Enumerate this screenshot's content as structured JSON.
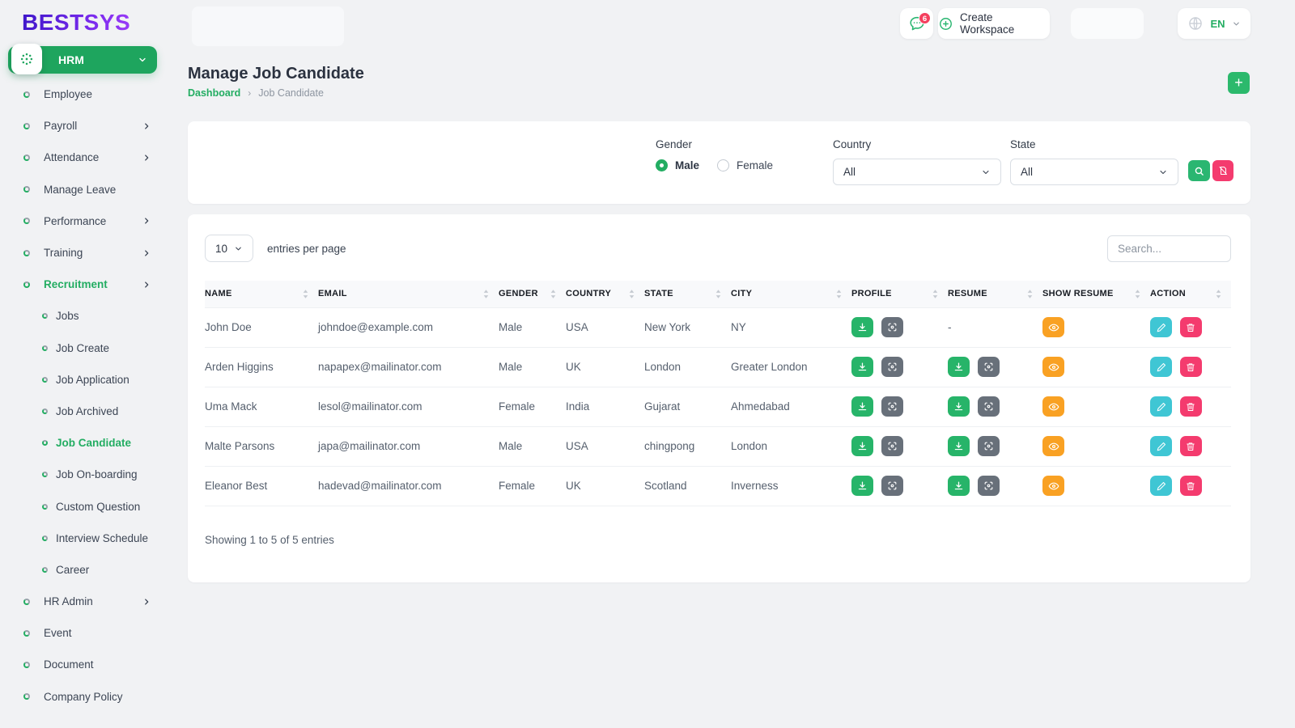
{
  "brand": {
    "logo_text": "BESTSYS"
  },
  "header": {
    "chat_badge_count": "6",
    "create_workspace_label": "Create Workspace",
    "language_code": "EN"
  },
  "sidebar": {
    "module_label": "HRM",
    "items": [
      {
        "label": "Employee",
        "chevron": false,
        "active": false,
        "indent": false
      },
      {
        "label": "Payroll",
        "chevron": true,
        "active": false,
        "indent": false
      },
      {
        "label": "Attendance",
        "chevron": true,
        "active": false,
        "indent": false
      },
      {
        "label": "Manage Leave",
        "chevron": false,
        "active": false,
        "indent": false
      },
      {
        "label": "Performance",
        "chevron": true,
        "active": false,
        "indent": false
      },
      {
        "label": "Training",
        "chevron": true,
        "active": false,
        "indent": false
      },
      {
        "label": "Recruitment",
        "chevron": true,
        "active": true,
        "indent": false
      },
      {
        "label": "Jobs",
        "chevron": false,
        "active": false,
        "indent": true
      },
      {
        "label": "Job Create",
        "chevron": false,
        "active": false,
        "indent": true
      },
      {
        "label": "Job Application",
        "chevron": false,
        "active": false,
        "indent": true
      },
      {
        "label": "Job Archived",
        "chevron": false,
        "active": false,
        "indent": true
      },
      {
        "label": "Job Candidate",
        "chevron": false,
        "active": true,
        "indent": true
      },
      {
        "label": "Job On-boarding",
        "chevron": false,
        "active": false,
        "indent": true
      },
      {
        "label": "Custom Question",
        "chevron": false,
        "active": false,
        "indent": true
      },
      {
        "label": "Interview Schedule",
        "chevron": false,
        "active": false,
        "indent": true
      },
      {
        "label": "Career",
        "chevron": false,
        "active": false,
        "indent": true
      },
      {
        "label": "HR Admin",
        "chevron": true,
        "active": false,
        "indent": false
      },
      {
        "label": "Event",
        "chevron": false,
        "active": false,
        "indent": false
      },
      {
        "label": "Document",
        "chevron": false,
        "active": false,
        "indent": false
      },
      {
        "label": "Company Policy",
        "chevron": false,
        "active": false,
        "indent": false
      }
    ]
  },
  "page": {
    "title": "Manage Job Candidate",
    "breadcrumb_home": "Dashboard",
    "breadcrumb_current": "Job Candidate"
  },
  "filters": {
    "gender_label": "Gender",
    "male_label": "Male",
    "female_label": "Female",
    "selected_gender": "Male",
    "country_label": "Country",
    "country_value": "All",
    "state_label": "State",
    "state_value": "All"
  },
  "table": {
    "page_size_value": "10",
    "entries_per_page_label": "entries per page",
    "search_placeholder": "Search...",
    "columns": [
      {
        "label": "NAME"
      },
      {
        "label": "EMAIL"
      },
      {
        "label": "GENDER"
      },
      {
        "label": "COUNTRY"
      },
      {
        "label": "STATE"
      },
      {
        "label": "CITY"
      },
      {
        "label": "PROFILE"
      },
      {
        "label": "RESUME"
      },
      {
        "label": "SHOW RESUME"
      },
      {
        "label": "ACTION"
      }
    ],
    "rows": [
      {
        "name": "John Doe",
        "email": "johndoe@example.com",
        "gender": "Male",
        "country": "USA",
        "state": "New York",
        "city": "NY",
        "has_resume": false
      },
      {
        "name": "Arden Higgins",
        "email": "napapex@mailinator.com",
        "gender": "Male",
        "country": "UK",
        "state": "London",
        "city": "Greater London",
        "has_resume": true
      },
      {
        "name": "Uma Mack",
        "email": "lesol@mailinator.com",
        "gender": "Female",
        "country": "India",
        "state": "Gujarat",
        "city": "Ahmedabad",
        "has_resume": true
      },
      {
        "name": "Malte Parsons",
        "email": "japa@mailinator.com",
        "gender": "Male",
        "country": "USA",
        "state": "chingpong",
        "city": "London",
        "has_resume": true
      },
      {
        "name": "Eleanor Best",
        "email": "hadevad@mailinator.com",
        "gender": "Female",
        "country": "UK",
        "state": "Scotland",
        "city": "Inverness",
        "has_resume": true
      }
    ],
    "resume_empty": "-",
    "footer_text": "Showing 1 to 5 of 5 entries"
  },
  "icons": {
    "chat-icon": "speech-bubble-with-dots",
    "create-workspace-icon": "plus-in-circle",
    "language-icon": "globe",
    "dropdown-icon": "chevron-down",
    "sidebar-expand-icon": "chevron-right",
    "sidebar-bullet-icon": "two-tone-ring",
    "module-icon": "dotted-circle",
    "sort-icon": "up-down-triangles",
    "search-icon": "magnifier",
    "clear-filter-icon": "document-slash",
    "add-icon": "plus",
    "download-icon": "arrow-down-to-tray",
    "view-profile-icon": "focus-frame",
    "show-resume-icon": "eye",
    "edit-icon": "pencil",
    "delete-icon": "trash-bin"
  },
  "colors": {
    "primary_green": "#23ad62",
    "button_green": "#2ab671",
    "pink": "#f43b6e",
    "orange": "#f9a123",
    "teal": "#3fc6d4",
    "gray_button": "#68707a",
    "brand_purple": "#5e22d8",
    "badge_red": "#f43f5e",
    "background": "#f1f2f4"
  }
}
